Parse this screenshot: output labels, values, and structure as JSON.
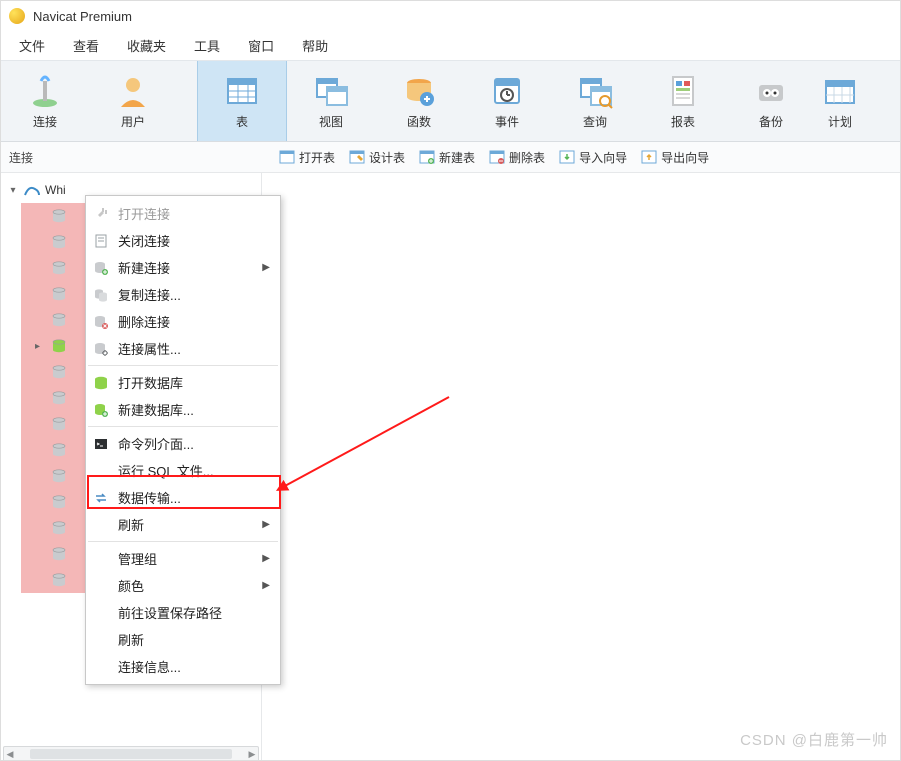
{
  "app": {
    "title": "Navicat Premium"
  },
  "menubar": [
    "文件",
    "查看",
    "收藏夹",
    "工具",
    "窗口",
    "帮助"
  ],
  "toolbar": [
    {
      "key": "connect",
      "label": "连接"
    },
    {
      "key": "user",
      "label": "用户"
    },
    {
      "key": "table",
      "label": "表",
      "active": true
    },
    {
      "key": "view",
      "label": "视图"
    },
    {
      "key": "function",
      "label": "函数"
    },
    {
      "key": "event",
      "label": "事件"
    },
    {
      "key": "query",
      "label": "查询"
    },
    {
      "key": "report",
      "label": "报表"
    },
    {
      "key": "backup",
      "label": "备份"
    },
    {
      "key": "schedule",
      "label": "计划"
    }
  ],
  "subbar": {
    "left_label": "连接",
    "actions": [
      "打开表",
      "设计表",
      "新建表",
      "删除表",
      "导入向导",
      "导出向导"
    ]
  },
  "sidebar": {
    "connection_name": "Whi",
    "db_rows": 15,
    "expanded_child_index": 5
  },
  "context_menu": {
    "items": [
      {
        "label": "打开连接",
        "icon": "plug-icon",
        "disabled": true
      },
      {
        "label": "关闭连接",
        "icon": "close-doc-icon"
      },
      {
        "label": "新建连接",
        "icon": "db-add-icon",
        "submenu": true
      },
      {
        "label": "复制连接...",
        "icon": "db-copy-icon"
      },
      {
        "label": "删除连接",
        "icon": "db-delete-icon"
      },
      {
        "label": "连接属性...",
        "icon": "db-settings-icon"
      },
      {
        "sep": true
      },
      {
        "label": "打开数据库",
        "icon": "db-open-icon"
      },
      {
        "label": "新建数据库...",
        "icon": "db-new-icon"
      },
      {
        "sep": true
      },
      {
        "label": "命令列介面...",
        "icon": "terminal-icon"
      },
      {
        "label": "运行 SQL 文件...",
        "highlighted": true
      },
      {
        "label": "数据传输...",
        "icon": "transfer-icon"
      },
      {
        "label": "刷新",
        "submenu": true
      },
      {
        "sep": true
      },
      {
        "label": "管理组",
        "submenu": true
      },
      {
        "label": "颜色",
        "submenu": true
      },
      {
        "label": "前往设置保存路径"
      },
      {
        "label": "刷新"
      },
      {
        "label": "连接信息..."
      }
    ]
  },
  "watermark": "CSDN @白鹿第一帅"
}
